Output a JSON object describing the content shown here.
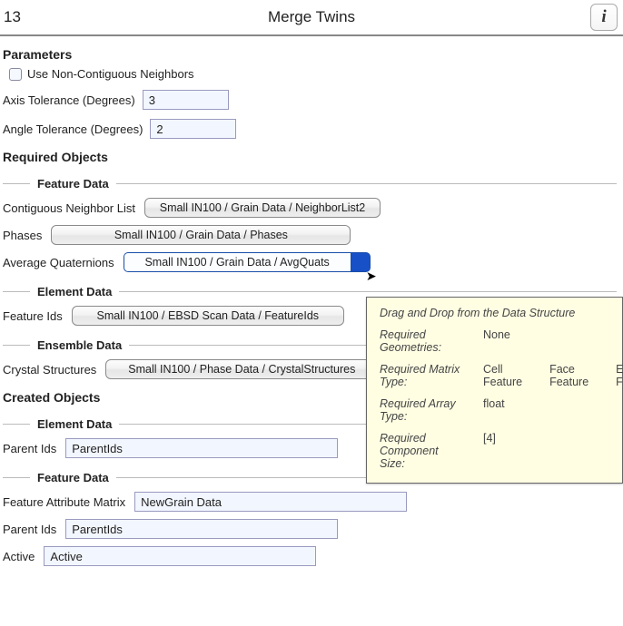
{
  "header": {
    "index": "13",
    "title": "Merge Twins",
    "info_icon": "i"
  },
  "sections": {
    "parameters_title": "Parameters",
    "use_noncontig_label": "Use Non-Contiguous Neighbors",
    "axis_tol_label": "Axis Tolerance (Degrees)",
    "axis_tol_value": "3",
    "angle_tol_label": "Angle Tolerance (Degrees)",
    "angle_tol_value": "2",
    "required_objects_title": "Required Objects",
    "feature_data_leg": "Feature Data",
    "element_data_leg": "Element Data",
    "ensemble_data_leg": "Ensemble Data",
    "contig_neighbor_label": "Contiguous Neighbor List",
    "contig_neighbor_value": "Small IN100 / Grain Data / NeighborList2",
    "phases_label": "Phases",
    "phases_value": "Small IN100 / Grain Data / Phases",
    "avg_quats_label": "Average Quaternions",
    "avg_quats_value": "Small IN100 / Grain Data / AvgQuats",
    "feature_ids_label": "Feature Ids",
    "feature_ids_value": "Small IN100 / EBSD Scan Data / FeatureIds",
    "crystal_struct_label": "Crystal Structures",
    "crystal_struct_value": "Small IN100 / Phase Data / CrystalStructures",
    "created_objects_title": "Created Objects",
    "parent_ids_label": "Parent Ids",
    "parent_ids_value": "ParentIds",
    "feature_attr_mx_label": "Feature Attribute Matrix",
    "feature_attr_mx_value": "NewGrain Data",
    "parent_ids2_label": "Parent Ids",
    "parent_ids2_value": "ParentIds",
    "active_label": "Active",
    "active_value": "Active"
  },
  "tooltip": {
    "title": "Drag and Drop from the Data Structure",
    "req_geom_key": "Required Geometries:",
    "req_geom_val": "None",
    "req_mx_key": "Required Matrix Type:",
    "req_mx_v1": "Cell Feature",
    "req_mx_v2": "Face Feature",
    "req_mx_v3": "Edge Feature",
    "req_arr_key": "Required Array Type:",
    "req_arr_val": "float",
    "req_comp_key": "Required Component Size:",
    "req_comp_val": "[4]"
  }
}
